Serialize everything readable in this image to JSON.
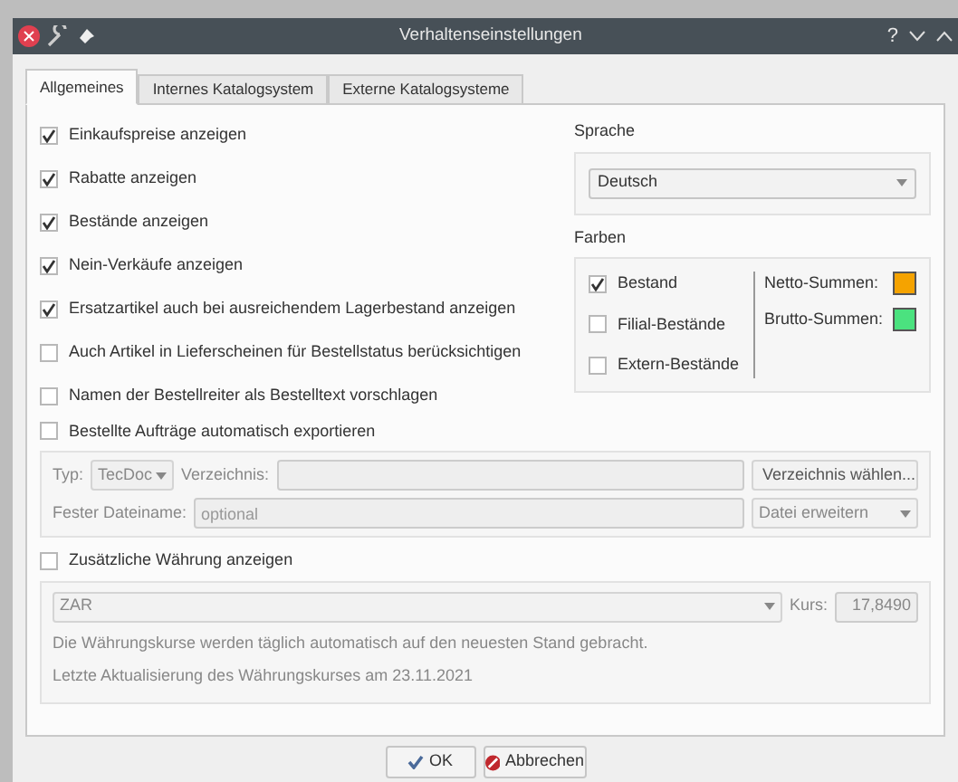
{
  "window": {
    "title": "Verhaltenseinstellungen",
    "controls": [
      "?"
    ]
  },
  "tabs": [
    {
      "label": "Allgemeines",
      "selected": true
    },
    {
      "label": "Internes Katalogsystem",
      "selected": false
    },
    {
      "label": "Externe Katalogsysteme",
      "selected": false
    }
  ],
  "options": [
    {
      "label": "Einkaufspreise anzeigen",
      "checked": true
    },
    {
      "label": "Rabatte anzeigen",
      "checked": true
    },
    {
      "label": "Bestände anzeigen",
      "checked": true
    },
    {
      "label": "Nein-Verkäufe anzeigen",
      "checked": true
    },
    {
      "label": "Ersatzartikel auch bei ausreichendem Lagerbestand anzeigen",
      "checked": true
    },
    {
      "label": "Auch Artikel in Lieferscheinen für Bestellstatus berücksichtigen",
      "checked": false
    },
    {
      "label": "Namen der Bestellreiter als Bestelltext vorschlagen",
      "checked": false
    }
  ],
  "language": {
    "label": "Sprache",
    "value": "Deutsch"
  },
  "colors": {
    "label": "Farben",
    "stock": [
      {
        "label": "Bestand",
        "checked": true
      },
      {
        "label": "Filial-Bestände",
        "checked": false
      },
      {
        "label": "Extern-Bestände",
        "checked": false
      }
    ],
    "sums": [
      {
        "label": "Netto-Summen:",
        "color": "#f5a300"
      },
      {
        "label": "Brutto-Summen:",
        "color": "#4be27f"
      }
    ]
  },
  "export": {
    "label": "Bestellte Aufträge automatisch exportieren",
    "checked": false,
    "type_label": "Typ:",
    "type_value": "TecDoc",
    "dir_label": "Verzeichnis:",
    "dir_button": "Verzeichnis wählen...",
    "file_label": "Fester Dateiname:",
    "file_placeholder": "optional",
    "mode_value": "Datei erweitern"
  },
  "currency": {
    "label": "Zusätzliche Währung anzeigen",
    "checked": false,
    "value": "ZAR",
    "rate_label": "Kurs:",
    "rate": "17,8490",
    "note": "Die Währungskurse werden täglich automatisch auf den neuesten Stand gebracht.",
    "updated": "Letzte Aktualisierung des Währungskurses am 23.11.2021"
  },
  "buttons": [
    {
      "label": "OK",
      "kind": "ok"
    },
    {
      "label": "Abbrechen",
      "kind": "cancel"
    }
  ]
}
